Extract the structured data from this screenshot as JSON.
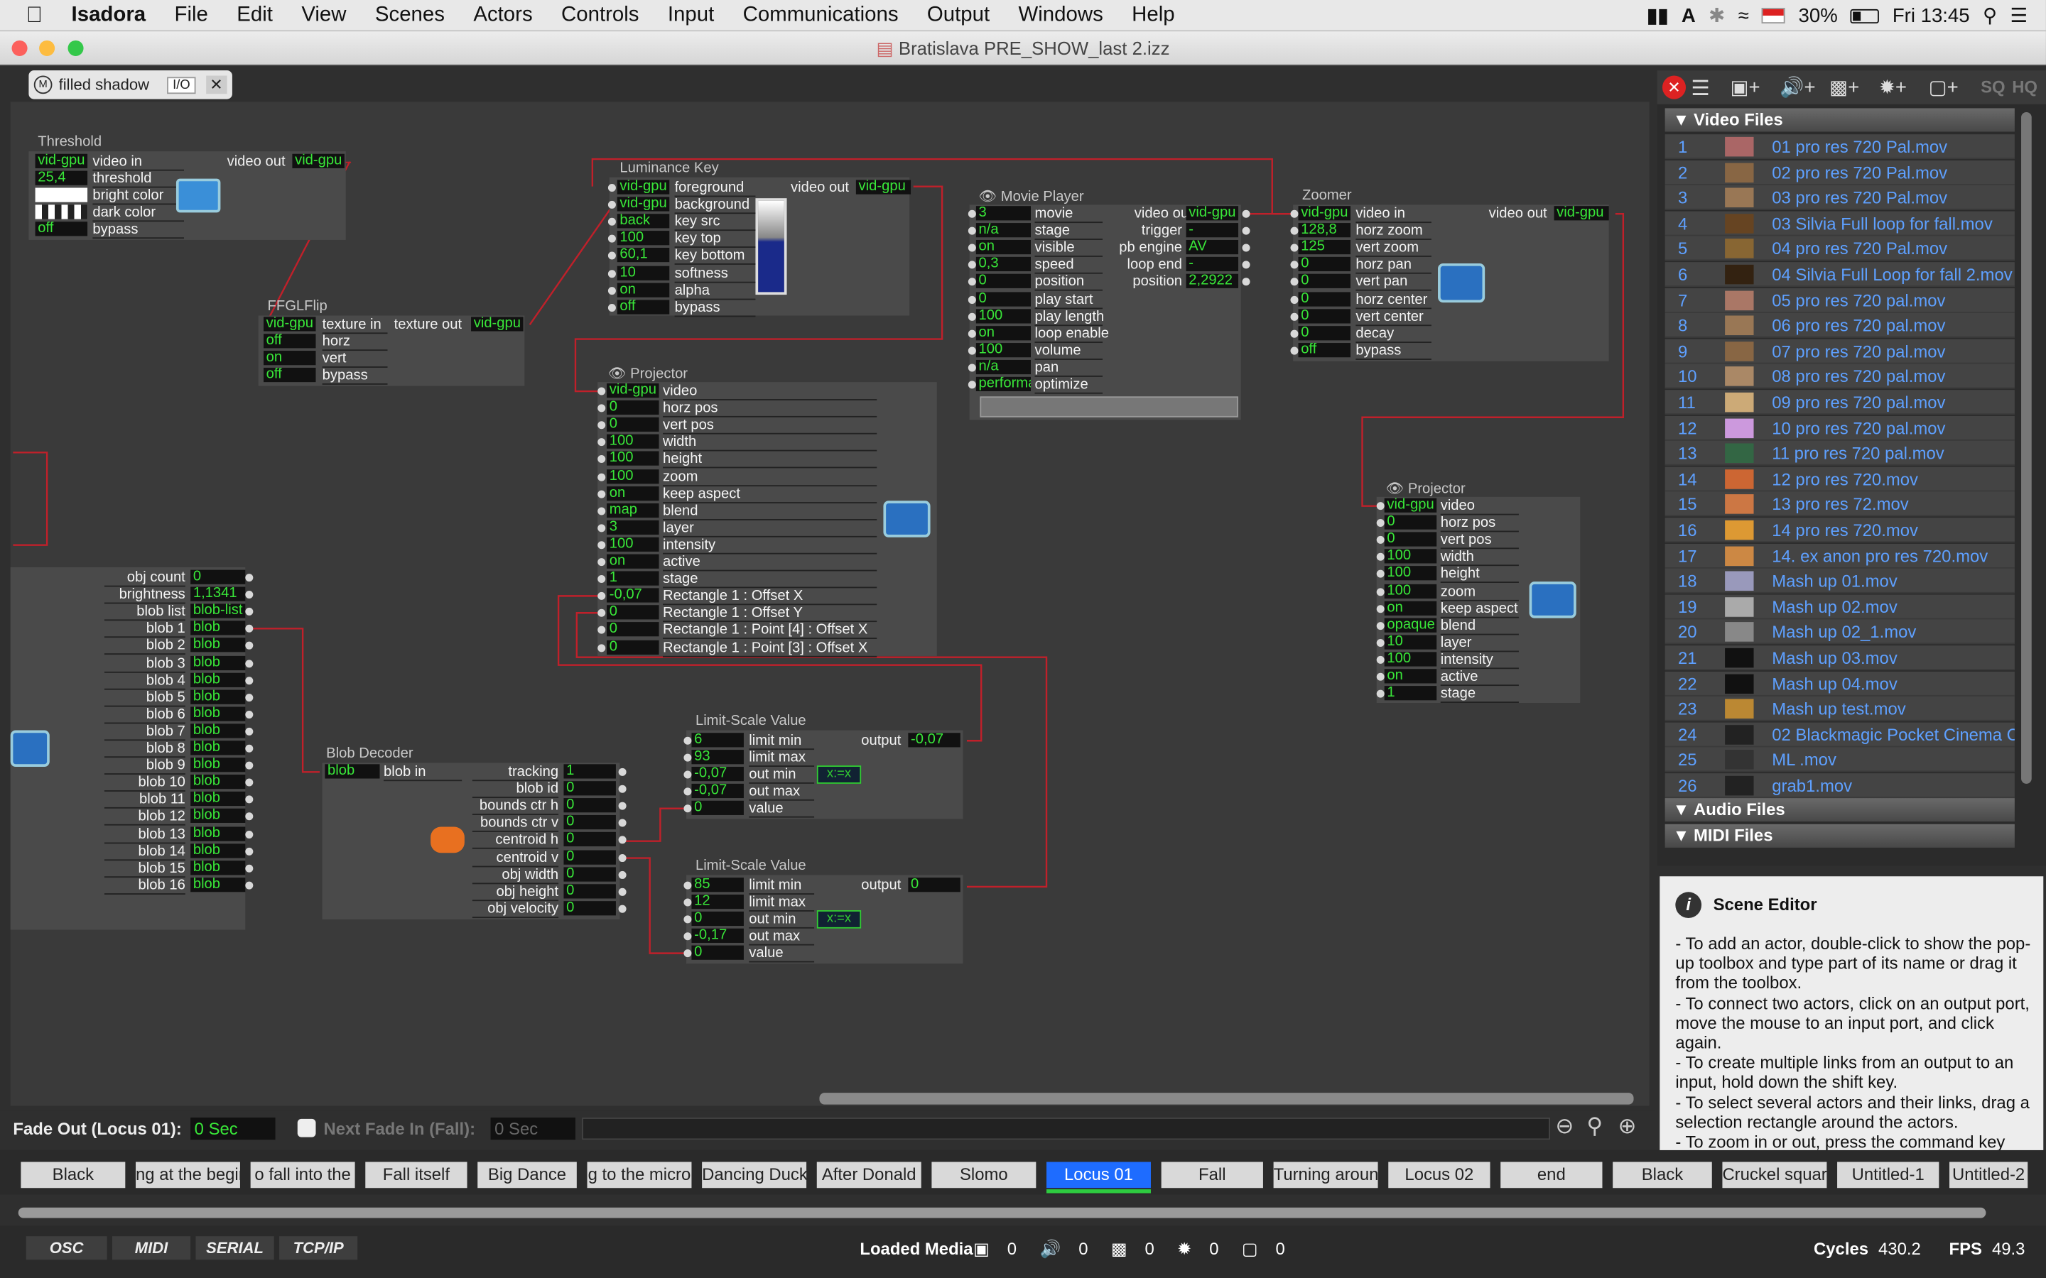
{
  "menubar": {
    "app": "Isadora",
    "items": [
      "File",
      "Edit",
      "View",
      "Scenes",
      "Actors",
      "Controls",
      "Input",
      "Communications",
      "Output",
      "Windows",
      "Help"
    ],
    "battery": "30%",
    "clock": "Fri 13:45"
  },
  "window": {
    "title": "Bratislava PRE_SHOW_last 2.izz"
  },
  "scene_tab": {
    "name": "filled shadow",
    "io": "I/O"
  },
  "actors": {
    "threshold": {
      "title": "Threshold",
      "rows": [
        [
          "vid-gpu",
          "video in"
        ],
        [
          "25,4",
          "threshold"
        ],
        [
          "",
          "bright color"
        ],
        [
          "",
          "dark color"
        ],
        [
          "off",
          "bypass"
        ]
      ],
      "out_label": "video out",
      "out_val": "vid-gpu"
    },
    "fglflip": {
      "title": "FFGLFlip",
      "rows": [
        [
          "vid-gpu",
          "texture in"
        ],
        [
          "off",
          "horz"
        ],
        [
          "on",
          "vert"
        ],
        [
          "off",
          "bypass"
        ]
      ],
      "out_label": "texture out",
      "out_val": "vid-gpu"
    },
    "lumakey": {
      "title": "Luminance Key",
      "rows": [
        [
          "vid-gpu",
          "foreground"
        ],
        [
          "vid-gpu",
          "background"
        ],
        [
          "back",
          "key src"
        ],
        [
          "100",
          "key top"
        ],
        [
          "60,1",
          "key bottom"
        ],
        [
          "10",
          "softness"
        ],
        [
          "on",
          "alpha"
        ],
        [
          "off",
          "bypass"
        ]
      ],
      "out_label": "video out",
      "out_val": "vid-gpu"
    },
    "movie": {
      "title": "Movie Player",
      "rows": [
        [
          "3",
          "movie"
        ],
        [
          "n/a",
          "stage"
        ],
        [
          "on",
          "visible"
        ],
        [
          "0,3",
          "speed"
        ],
        [
          "0",
          "position"
        ],
        [
          "0",
          "play start"
        ],
        [
          "100",
          "play length"
        ],
        [
          "on",
          "loop enable"
        ],
        [
          "100",
          "volume"
        ],
        [
          "n/a",
          "pan"
        ],
        [
          "performa",
          "optimize"
        ]
      ],
      "outs": [
        [
          "video out",
          "vid-gpu"
        ],
        [
          "trigger",
          "-"
        ],
        [
          "pb engine",
          "AV"
        ],
        [
          "loop end",
          "-"
        ],
        [
          "position",
          "2,2922"
        ]
      ]
    },
    "zoomer": {
      "title": "Zoomer",
      "rows": [
        [
          "vid-gpu",
          "video in"
        ],
        [
          "128,8",
          "horz zoom"
        ],
        [
          "125",
          "vert zoom"
        ],
        [
          "0",
          "horz pan"
        ],
        [
          "0",
          "vert pan"
        ],
        [
          "0",
          "horz center"
        ],
        [
          "0",
          "vert center"
        ],
        [
          "0",
          "decay"
        ],
        [
          "off",
          "bypass"
        ]
      ],
      "out_label": "video out",
      "out_val": "vid-gpu"
    },
    "projector1": {
      "title": "Projector",
      "rows": [
        [
          "vid-gpu",
          "video"
        ],
        [
          "0",
          "horz pos"
        ],
        [
          "0",
          "vert pos"
        ],
        [
          "100",
          "width"
        ],
        [
          "100",
          "height"
        ],
        [
          "100",
          "zoom"
        ],
        [
          "on",
          "keep aspect"
        ],
        [
          "map",
          "blend"
        ],
        [
          "3",
          "layer"
        ],
        [
          "100",
          "intensity"
        ],
        [
          "on",
          "active"
        ],
        [
          "1",
          "stage"
        ],
        [
          "-0,07",
          "Rectangle 1 : Offset X"
        ],
        [
          "0",
          "Rectangle 1 : Offset Y"
        ],
        [
          "0",
          "Rectangle 1 : Point [4] : Offset X"
        ],
        [
          "0",
          "Rectangle 1 : Point [3] : Offset X"
        ]
      ]
    },
    "projector2": {
      "title": "Projector",
      "rows": [
        [
          "vid-gpu",
          "video"
        ],
        [
          "0",
          "horz pos"
        ],
        [
          "0",
          "vert pos"
        ],
        [
          "100",
          "width"
        ],
        [
          "100",
          "height"
        ],
        [
          "100",
          "zoom"
        ],
        [
          "on",
          "keep aspect"
        ],
        [
          "opaque",
          "blend"
        ],
        [
          "10",
          "layer"
        ],
        [
          "100",
          "intensity"
        ],
        [
          "on",
          "active"
        ],
        [
          "1",
          "stage"
        ]
      ]
    },
    "blobs": {
      "rows": [
        [
          "obj count",
          "0"
        ],
        [
          "brightness",
          "1,1341"
        ],
        [
          "blob list",
          "blob-list"
        ],
        [
          "blob 1",
          "blob"
        ],
        [
          "blob 2",
          "blob"
        ],
        [
          "blob 3",
          "blob"
        ],
        [
          "blob 4",
          "blob"
        ],
        [
          "blob 5",
          "blob"
        ],
        [
          "blob 6",
          "blob"
        ],
        [
          "blob 7",
          "blob"
        ],
        [
          "blob 8",
          "blob"
        ],
        [
          "blob 9",
          "blob"
        ],
        [
          "blob 10",
          "blob"
        ],
        [
          "blob 11",
          "blob"
        ],
        [
          "blob 12",
          "blob"
        ],
        [
          "blob 13",
          "blob"
        ],
        [
          "blob 14",
          "blob"
        ],
        [
          "blob 15",
          "blob"
        ],
        [
          "blob 16",
          "blob"
        ]
      ]
    },
    "blobdecoder": {
      "title": "Blob Decoder",
      "in_val": "blob",
      "in_label": "blob in",
      "rows": [
        [
          "tracking",
          "1"
        ],
        [
          "blob id",
          "0"
        ],
        [
          "bounds ctr h",
          "0"
        ],
        [
          "bounds ctr v",
          "0"
        ],
        [
          "centroid h",
          "0"
        ],
        [
          "centroid v",
          "0"
        ],
        [
          "obj width",
          "0"
        ],
        [
          "obj height",
          "0"
        ],
        [
          "obj velocity",
          "0"
        ]
      ]
    },
    "lsv1": {
      "title": "Limit-Scale Value",
      "rows": [
        [
          "6",
          "limit min"
        ],
        [
          "93",
          "limit max"
        ],
        [
          "-0,07",
          "out min"
        ],
        [
          "-0,07",
          "out max"
        ],
        [
          "0",
          "value"
        ]
      ],
      "out_label": "output",
      "out_val": "-0,07"
    },
    "lsv2": {
      "title": "Limit-Scale Value",
      "rows": [
        [
          "85",
          "limit min"
        ],
        [
          "12",
          "limit max"
        ],
        [
          "0",
          "out min"
        ],
        [
          "-0,17",
          "out max"
        ],
        [
          "0",
          "value"
        ]
      ],
      "out_label": "output",
      "out_val": "0"
    }
  },
  "media_panel": {
    "sections": [
      "Video Files",
      "Audio Files",
      "MIDI Files"
    ],
    "video_files": [
      [
        "1",
        "01 pro res 720 Pal.mov"
      ],
      [
        "2",
        "02 pro res 720 Pal.mov"
      ],
      [
        "3",
        "03 pro res 720 Pal.mov"
      ],
      [
        "4",
        "03 Silvia Full loop for fall.mov"
      ],
      [
        "5",
        "04 pro res 720 Pal.mov"
      ],
      [
        "6",
        "04 Silvia Full Loop for fall 2.mov"
      ],
      [
        "7",
        "05 pro res 720 pal.mov"
      ],
      [
        "8",
        "06 pro res 720 pal.mov"
      ],
      [
        "9",
        "07 pro res 720 pal.mov"
      ],
      [
        "10",
        "08 pro res 720 pal.mov"
      ],
      [
        "11",
        "09 pro res 720 pal.mov"
      ],
      [
        "12",
        "10 pro res 720 pal.mov"
      ],
      [
        "13",
        "11 pro res 720 pal.mov"
      ],
      [
        "14",
        "12 pro res 720.mov"
      ],
      [
        "15",
        "13 pro res 72.mov"
      ],
      [
        "16",
        "14 pro res 720.mov"
      ],
      [
        "17",
        "14. ex anon pro res 720.mov"
      ],
      [
        "18",
        "Mash up 01.mov"
      ],
      [
        "19",
        "Mash up 02.mov"
      ],
      [
        "20",
        "Mash up 02_1.mov"
      ],
      [
        "21",
        "Mash up 03.mov"
      ],
      [
        "22",
        "Mash up 04.mov"
      ],
      [
        "23",
        "Mash up test.mov"
      ],
      [
        "24",
        "02 Blackmagic Pocket Cinema C"
      ],
      [
        "25",
        "ML .mov"
      ],
      [
        "26",
        "grab1.mov"
      ]
    ],
    "toolbar": [
      "SQ",
      "HQ"
    ]
  },
  "help": {
    "title": "Scene Editor",
    "lines": [
      "- To add an actor, double-click to show the pop-up toolbox and type part of its name or drag it from the toolbox.",
      "- To connect two actors, click on an output port, move the mouse to an input port, and click again.",
      "- To create multiple links from an output to an input, hold down the shift key.",
      "- To select several actors and their links, drag a selection rectangle around the actors.",
      "- To zoom in or out, press the command key"
    ]
  },
  "fade": {
    "out_label": "Fade Out (Locus 01):",
    "out_val": "0 Sec",
    "next_label": "Next Fade In (Fall):",
    "next_val": "0 Sec"
  },
  "scenes": [
    "Black",
    "ng at the begin",
    "o fall into the",
    "Fall itself",
    "Big Dance",
    "g to the micro",
    "Dancing Duck",
    "After Donald",
    "Slomo",
    "Locus 01",
    "Fall",
    "Turning around",
    "Locus 02",
    "end",
    "Black",
    "Cruckel square",
    "Untitled-1",
    "Untitled-2"
  ],
  "active_scene": "Locus 01",
  "status": {
    "buttons": [
      "OSC",
      "MIDI",
      "SERIAL",
      "TCP/IP"
    ],
    "loaded_media_label": "Loaded Media",
    "counts": [
      "0",
      "0",
      "0",
      "0",
      "0"
    ],
    "cycles_label": "Cycles",
    "cycles": "430.2",
    "fps_label": "FPS",
    "fps": "49.3"
  },
  "colors": {
    "accent": "#1e6cff",
    "wire": "#c0202a",
    "value_text": "#39e639"
  }
}
